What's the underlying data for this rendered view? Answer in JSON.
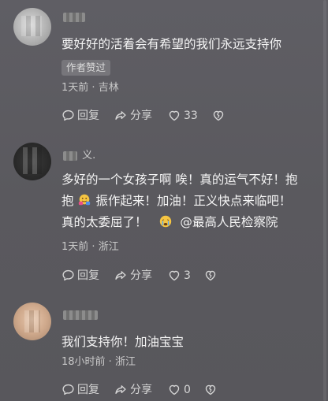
{
  "comments": [
    {
      "username_suffix": "",
      "text": "要好好的活着会有希望的我们永远支持你",
      "author_liked_badge": "作者赞过",
      "time": "1天前",
      "location": "吉林",
      "reply_label": "回复",
      "share_label": "分享",
      "like_count": "33"
    },
    {
      "username_suffix": "义.",
      "text_line1": "多好的一个女孩子啊 唉！真的运气不好！抱",
      "text_line2_a": "抱",
      "text_line2_b": "振作起来！加油！正义快点来临吧！",
      "text_line3_a": "真的太委屈了！",
      "mention": "@最高人民检察院",
      "time": "1天前",
      "location": "浙江",
      "reply_label": "回复",
      "share_label": "分享",
      "like_count": "3"
    },
    {
      "username_suffix": "",
      "text": "我们支持你！加油宝宝",
      "time": "18小时前",
      "location": "浙江",
      "reply_label": "回复",
      "share_label": "分享",
      "like_count": "0"
    }
  ],
  "meta_separator": " · ",
  "icons": {
    "reply": "comment-bubble-icon",
    "share": "share-arrow-icon",
    "like": "heart-icon",
    "dislike": "broken-heart-icon"
  },
  "colors": {
    "background": "#5d5c61",
    "text": "#f4f4f4",
    "secondary_text": "#c9c9c9",
    "badge_bg": "#77767b"
  }
}
